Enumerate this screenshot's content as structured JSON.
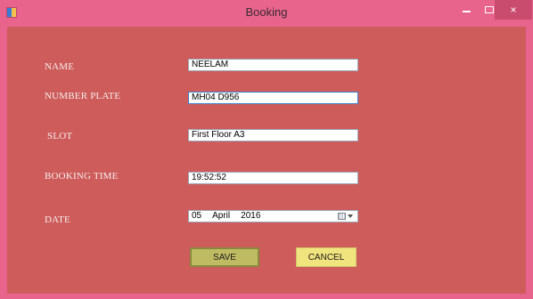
{
  "window": {
    "title": "Booking",
    "minimize": "–",
    "close": "×"
  },
  "form": {
    "name": {
      "label": "NAME",
      "value": "NEELAM"
    },
    "number_plate": {
      "label": "NUMBER PLATE",
      "value": "MH04 D956"
    },
    "slot": {
      "label": "SLOT",
      "value": "First Floor A3"
    },
    "booking_time": {
      "label": "BOOKING TIME",
      "value": "19:52:52"
    },
    "date": {
      "label": "DATE",
      "day": "05",
      "month": "April",
      "year": "2016"
    }
  },
  "buttons": {
    "save": "SAVE",
    "cancel": "CANCEL"
  },
  "colors": {
    "titlebar": "#e8648d",
    "client_bg": "#cd5c5a",
    "save_button": "#bfbb62",
    "cancel_button": "#f0e47e"
  }
}
